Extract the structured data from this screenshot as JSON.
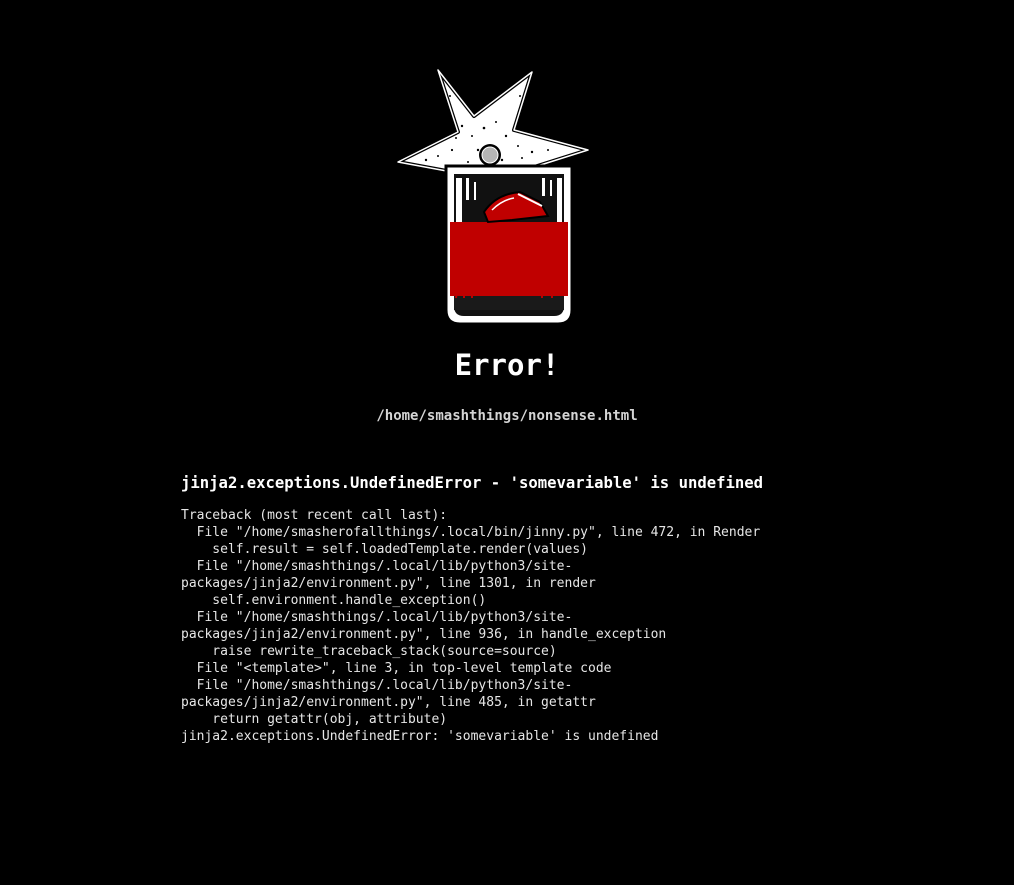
{
  "page": {
    "title": "Error!",
    "path": "/home/smashthings/nonsense.html"
  },
  "logo": {
    "icon": "shuriken-glass-logo",
    "colors": {
      "fill": "#c00000",
      "outline": "#ffffff",
      "ink": "#000000"
    }
  },
  "error": {
    "heading": "jinja2.exceptions.UndefinedError - 'somevariable' is undefined",
    "traceback_lines": [
      "Traceback (most recent call last):",
      "  File \"/home/smasherofallthings/.local/bin/jinny.py\", line 472, in Render",
      "    self.result = self.loadedTemplate.render(values)",
      "  File \"/home/smashthings/.local/lib/python3/site-",
      "packages/jinja2/environment.py\", line 1301, in render",
      "    self.environment.handle_exception()",
      "  File \"/home/smashthings/.local/lib/python3/site-",
      "packages/jinja2/environment.py\", line 936, in handle_exception",
      "    raise rewrite_traceback_stack(source=source)",
      "  File \"<template>\", line 3, in top-level template code",
      "  File \"/home/smashthings/.local/lib/python3/site-",
      "packages/jinja2/environment.py\", line 485, in getattr",
      "    return getattr(obj, attribute)",
      "jinja2.exceptions.UndefinedError: 'somevariable' is undefined"
    ]
  }
}
